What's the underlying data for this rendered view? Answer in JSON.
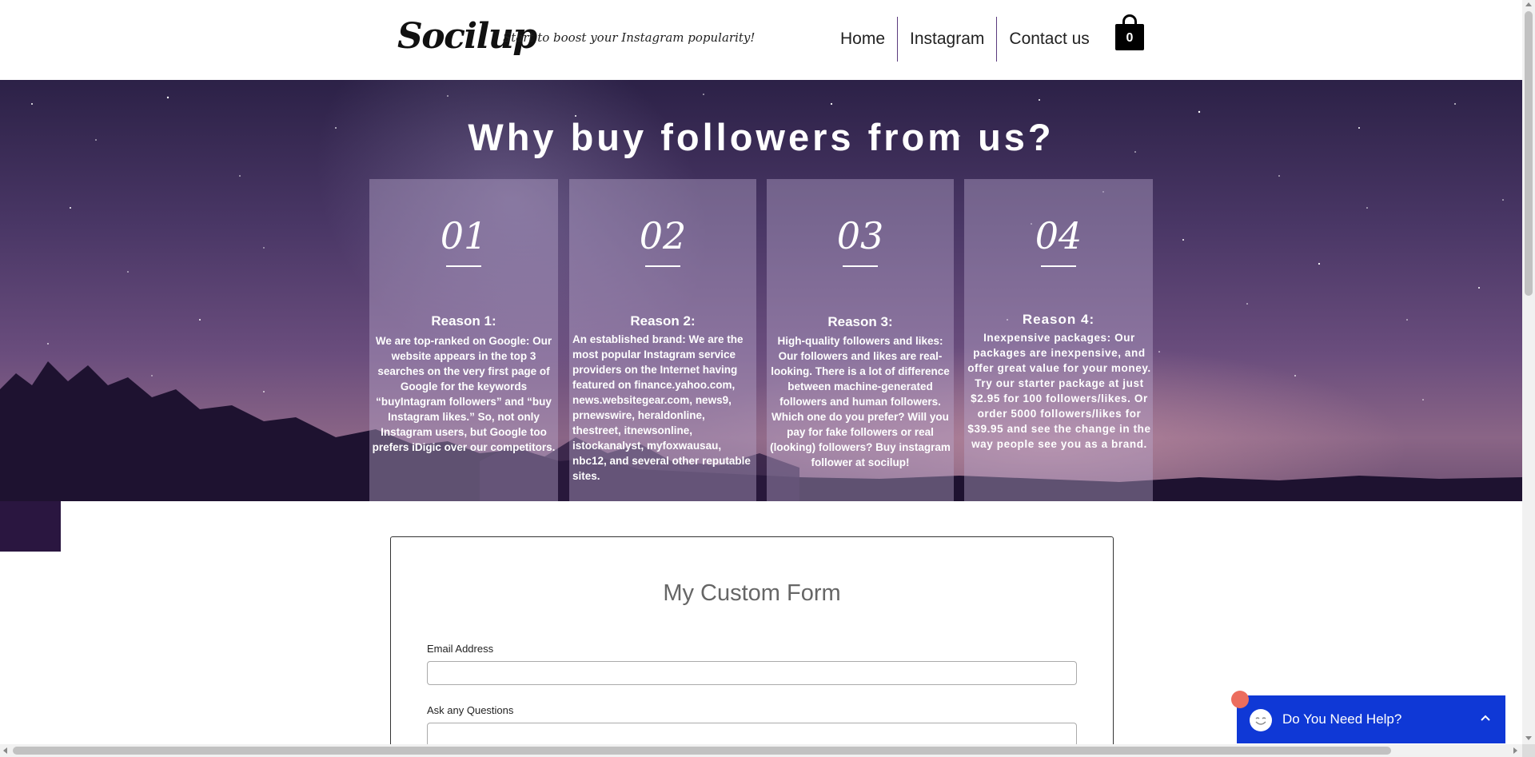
{
  "header": {
    "logo": "Socilup",
    "tagline": "Start to boost your Instagram popularity!",
    "nav": [
      "Home",
      "Instagram",
      "Contact us"
    ],
    "cart_count": "0",
    "cart_icon": "shopping-bag-icon"
  },
  "hero": {
    "title": "Why buy followers from us?",
    "cards": [
      {
        "number": "01",
        "title": "Reason 1:",
        "body": "We are top-ranked on Google: Our website appears in the top 3 searches on the very first page of Google for the keywords “buyIntagram followers” and “buy Instagram likes.” So, not only Instagram users, but Google too prefers iDigic over our competitors."
      },
      {
        "number": "02",
        "title": "Reason 2:",
        "body": "An established brand: We are the most popular Instagram service providers on the Internet having featured on finance.yahoo.com, news.websitegear.com, news9, prnewswire, heraldonline, thestreet, itnewsonline, istockanalyst, myfoxwausau, nbc12, and several other reputable sites."
      },
      {
        "number": "03",
        "title": "Reason 3:",
        "body": "High-quality followers and likes: Our followers and likes are real-looking. There is a lot of difference between machine-generated followers and human followers. Which one do you prefer? Will you pay for fake followers or real (looking) followers? Buy instagram follower at socilup!"
      },
      {
        "number": "04",
        "title": "Reason 4:",
        "body": "Inexpensive packages: Our packages are inexpensive, and offer great value for your money. Try our starter package at just $2.95 for 100 followers/likes. Or order 5000 followers/likes for $39.95 and see the change in the way people see you as a brand."
      }
    ]
  },
  "form": {
    "title": "My Custom Form",
    "email_label": "Email Address",
    "email_value": "",
    "question_label": "Ask any Questions",
    "question_value": ""
  },
  "chat": {
    "label": "Do You Need Help?",
    "icon": "smiley-icon",
    "toggle_icon": "chevron-up-icon"
  }
}
